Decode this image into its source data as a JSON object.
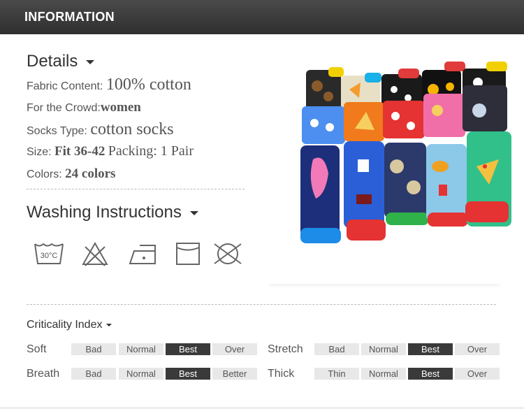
{
  "header": {
    "title": "INFORMATION"
  },
  "details": {
    "title": "Details",
    "fabric": {
      "label": "Fabric Content:",
      "value": "100% cotton"
    },
    "crowd": {
      "label": "For the Crowd:",
      "value": "women"
    },
    "type": {
      "label": "Socks Type:",
      "value": "cotton socks"
    },
    "size": {
      "label": "Size:",
      "value": "Fit 36-42",
      "packing": "Packing: 1 Pair"
    },
    "colors": {
      "label": "Colors:",
      "value": "24 colors"
    }
  },
  "washing": {
    "title": "Washing Instructions",
    "icons": [
      "wash-30-icon",
      "no-bleach-icon",
      "iron-low-icon",
      "tumble-dry-icon",
      "no-dry-clean-icon"
    ],
    "wash_temp": "30°C"
  },
  "criticality": {
    "title": "Criticality Index",
    "rows": [
      {
        "name": "Soft",
        "options": [
          "Bad",
          "Normal",
          "Best",
          "Over"
        ],
        "selected": 2
      },
      {
        "name": "Stretch",
        "options": [
          "Bad",
          "Normal",
          "Best",
          "Over"
        ],
        "selected": 2
      },
      {
        "name": "Breath",
        "options": [
          "Bad",
          "Normal",
          "Best",
          "Better"
        ],
        "selected": 2
      },
      {
        "name": "Thick",
        "options": [
          "Thin",
          "Normal",
          "Best",
          "Over"
        ],
        "selected": 2
      }
    ]
  },
  "colors": {
    "header_bg": "#3a3a3a",
    "selected_cell": "#3a3a3a",
    "cell": "#e8e8e8"
  }
}
